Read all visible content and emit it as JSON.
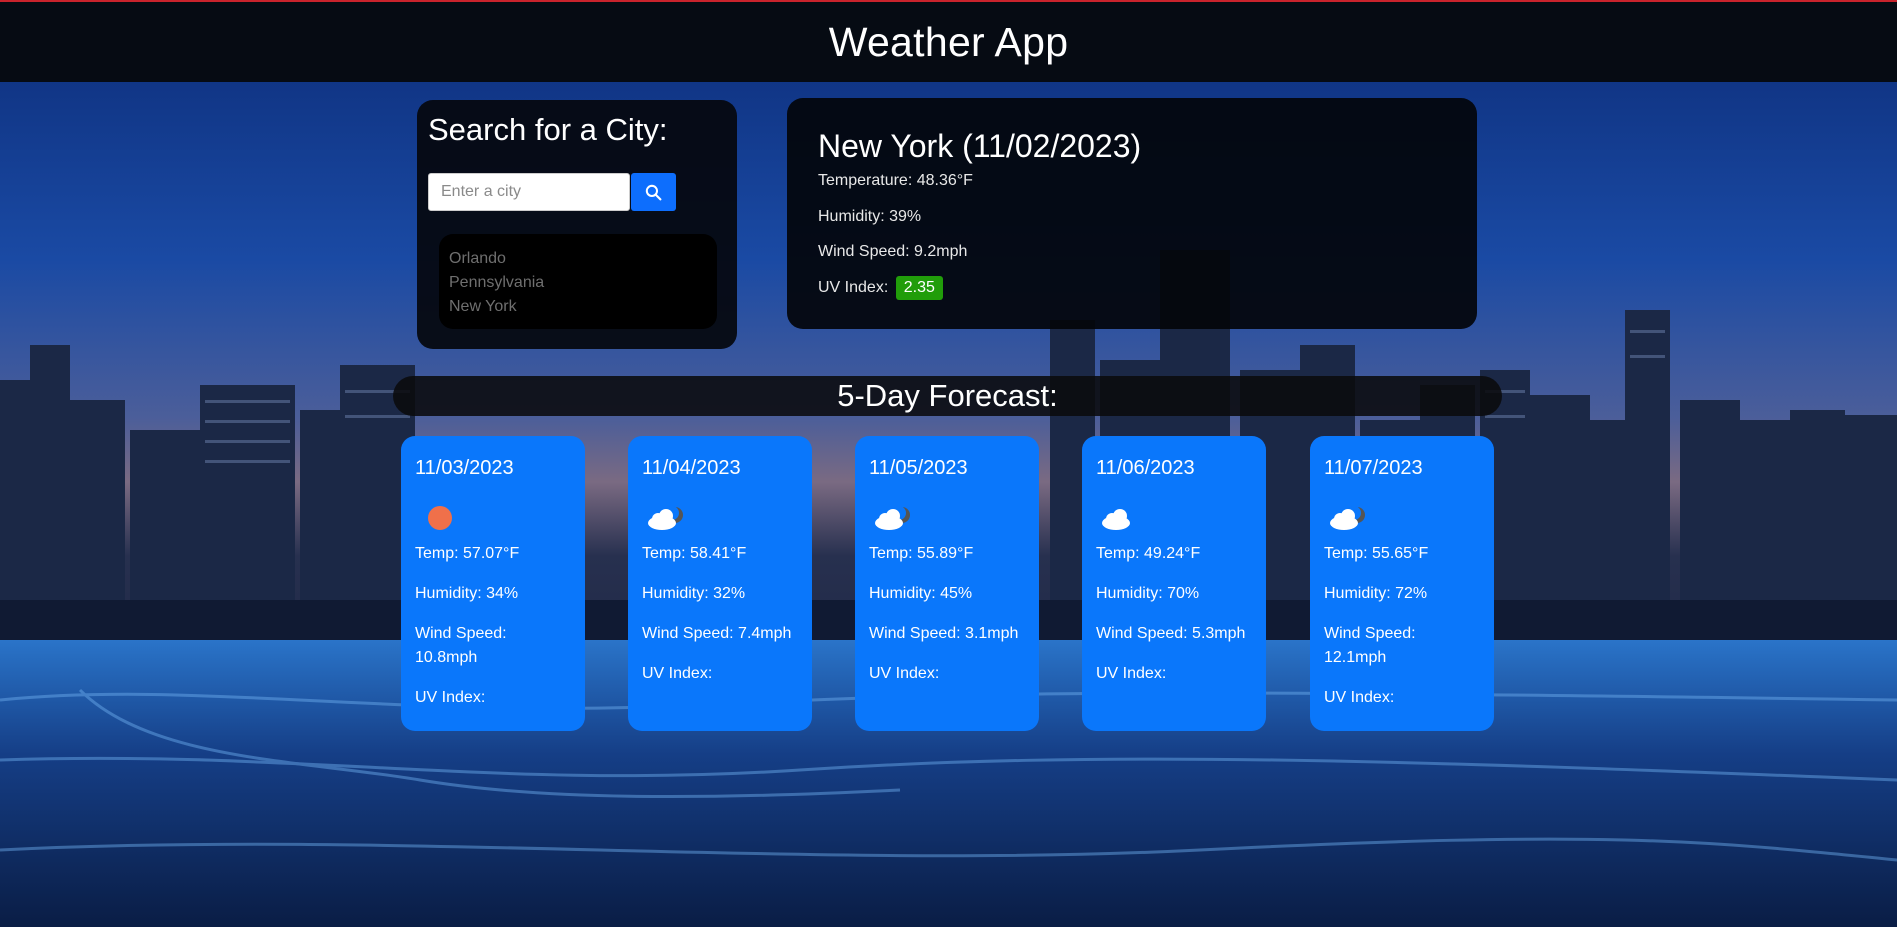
{
  "header": {
    "title": "Weather App"
  },
  "search": {
    "title": "Search for a City:",
    "placeholder": "Enter a city",
    "value": "",
    "button_icon": "search-icon",
    "history": [
      "Orlando",
      "Pennsylvania",
      "New York"
    ]
  },
  "current": {
    "title": "New York (11/02/2023)",
    "temperature": "Temperature: 48.36°F",
    "humidity": "Humidity: 39%",
    "wind": "Wind Speed: 9.2mph",
    "uv_label": "UV Index:",
    "uv_value": "2.35",
    "uv_color": "#219d0a"
  },
  "forecast": {
    "title": "5-Day Forecast:",
    "days": [
      {
        "date": "11/03/2023",
        "icon": "sun-icon",
        "temp": "Temp: 57.07°F",
        "humidity": "Humidity: 34%",
        "wind": "Wind Speed: 10.8mph",
        "uv": "UV Index:"
      },
      {
        "date": "11/04/2023",
        "icon": "cloudy-night-icon",
        "temp": "Temp: 58.41°F",
        "humidity": "Humidity: 32%",
        "wind": "Wind Speed: 7.4mph",
        "uv": "UV Index:"
      },
      {
        "date": "11/05/2023",
        "icon": "cloudy-night-icon",
        "temp": "Temp: 55.89°F",
        "humidity": "Humidity: 45%",
        "wind": "Wind Speed: 3.1mph",
        "uv": "UV Index:"
      },
      {
        "date": "11/06/2023",
        "icon": "cloud-icon",
        "temp": "Temp: 49.24°F",
        "humidity": "Humidity: 70%",
        "wind": "Wind Speed: 5.3mph",
        "uv": "UV Index:"
      },
      {
        "date": "11/07/2023",
        "icon": "cloudy-night-icon",
        "temp": "Temp: 55.65°F",
        "humidity": "Humidity: 72%",
        "wind": "Wind Speed: 12.1mph",
        "uv": "UV Index:"
      }
    ]
  },
  "colors": {
    "accent": "#0a77fb",
    "header_bg": "#060b13",
    "header_line": "#c8232c"
  }
}
